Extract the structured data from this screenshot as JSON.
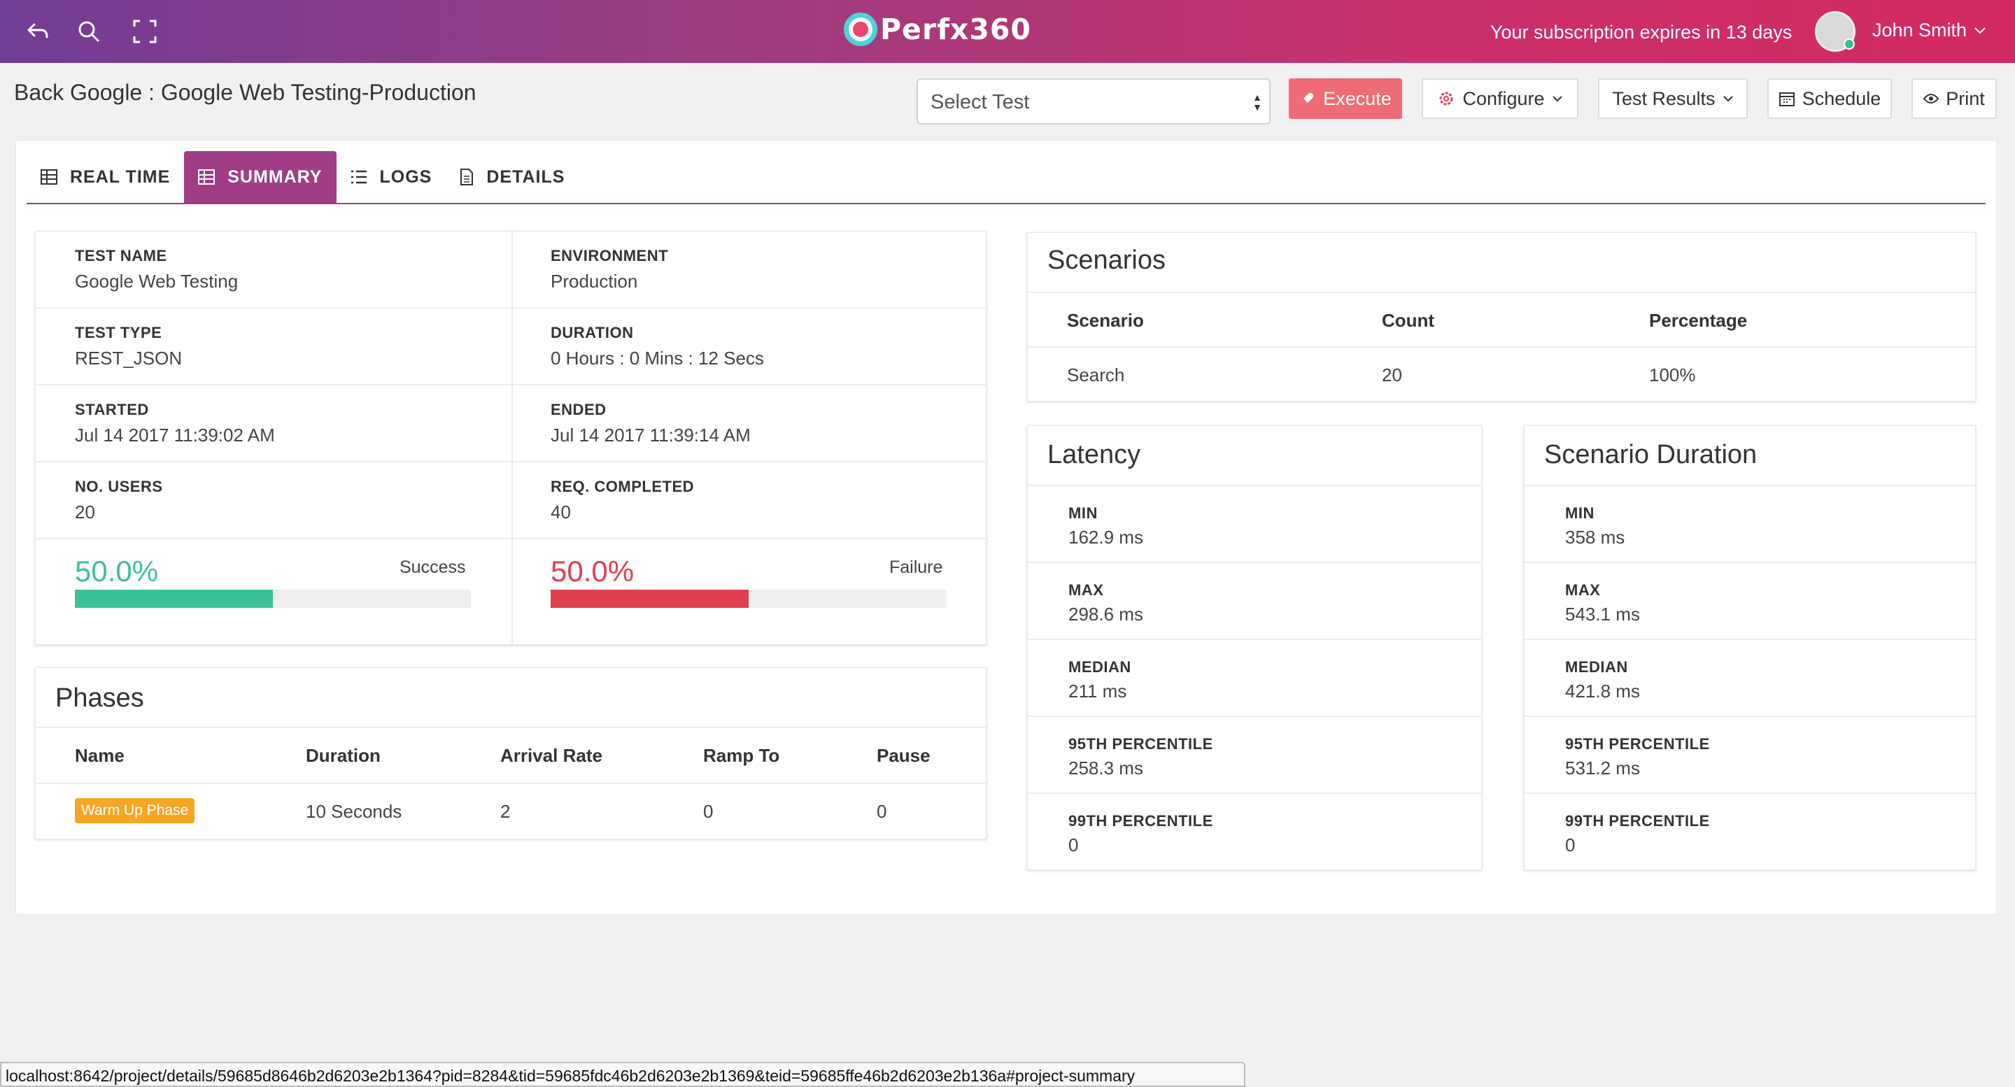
{
  "topbar": {
    "logo_text": "Perfx360",
    "subscription_text": "Your subscription expires in 13 days",
    "user_name": "John Smith",
    "colors": {
      "gradient_start": "#713d95",
      "gradient_end": "#d32a61"
    },
    "icons": [
      "back-icon",
      "search-icon",
      "fullscreen-icon"
    ]
  },
  "header": {
    "title": "Back Google : Google Web Testing-Production",
    "select_test": "Select Test",
    "buttons": {
      "execute": "Execute",
      "configure": "Configure",
      "test_results": "Test Results",
      "schedule": "Schedule",
      "print": "Print"
    }
  },
  "tabs": [
    {
      "label": "REAL TIME",
      "icon": "grid-icon"
    },
    {
      "label": "SUMMARY",
      "icon": "grid-icon",
      "active": true
    },
    {
      "label": "LOGS",
      "icon": "list-icon"
    },
    {
      "label": "DETAILS",
      "icon": "document-icon"
    }
  ],
  "info": {
    "test_name": {
      "label": "TEST NAME",
      "value": "Google Web Testing"
    },
    "environment": {
      "label": "ENVIRONMENT",
      "value": "Production"
    },
    "test_type": {
      "label": "TEST TYPE",
      "value": "REST_JSON"
    },
    "duration": {
      "label": "DURATION",
      "value": "0 Hours : 0 Mins : 12 Secs"
    },
    "started": {
      "label": "STARTED",
      "value": "Jul 14 2017 11:39:02 AM"
    },
    "ended": {
      "label": "ENDED",
      "value": "Jul 14 2017 11:39:14 AM"
    },
    "users": {
      "label": "NO. USERS",
      "value": "20"
    },
    "req_completed": {
      "label": "REQ. COMPLETED",
      "value": "40"
    },
    "success": {
      "percent_text": "50.0%",
      "label": "Success",
      "fraction": 0.5,
      "color": "#3dbf9a"
    },
    "failure": {
      "percent_text": "50.0%",
      "label": "Failure",
      "fraction": 0.5,
      "color": "#e0404e"
    }
  },
  "phases": {
    "title": "Phases",
    "columns": [
      "Name",
      "Duration",
      "Arrival Rate",
      "Ramp To",
      "Pause"
    ],
    "rows": [
      {
        "name": "Warm Up Phase",
        "duration": "10 Seconds",
        "arrival_rate": "2",
        "ramp_to": "0",
        "pause": "0"
      }
    ]
  },
  "scenarios": {
    "title": "Scenarios",
    "columns": [
      "Scenario",
      "Count",
      "Percentage"
    ],
    "rows": [
      {
        "scenario": "Search",
        "count": "20",
        "percentage": "100%"
      }
    ]
  },
  "latency": {
    "title": "Latency",
    "metrics": [
      {
        "label": "MIN",
        "value": "162.9 ms"
      },
      {
        "label": "MAX",
        "value": "298.6 ms"
      },
      {
        "label": "MEDIAN",
        "value": "211 ms"
      },
      {
        "label": "95TH PERCENTILE",
        "value": "258.3 ms"
      },
      {
        "label": "99TH PERCENTILE",
        "value": "0"
      }
    ]
  },
  "scenario_duration": {
    "title": "Scenario Duration",
    "metrics": [
      {
        "label": "MIN",
        "value": "358 ms"
      },
      {
        "label": "MAX",
        "value": "543.1 ms"
      },
      {
        "label": "MEDIAN",
        "value": "421.8 ms"
      },
      {
        "label": "95TH PERCENTILE",
        "value": "531.2 ms"
      },
      {
        "label": "99TH PERCENTILE",
        "value": "0"
      }
    ]
  },
  "statusbar": {
    "url": "localhost:8642/project/details/59685d8646b2d6203e2b1364?pid=8284&tid=59685fdc46b2d6203e2b1369&teid=59685ffe46b2d6203e2b136a#project-summary"
  }
}
